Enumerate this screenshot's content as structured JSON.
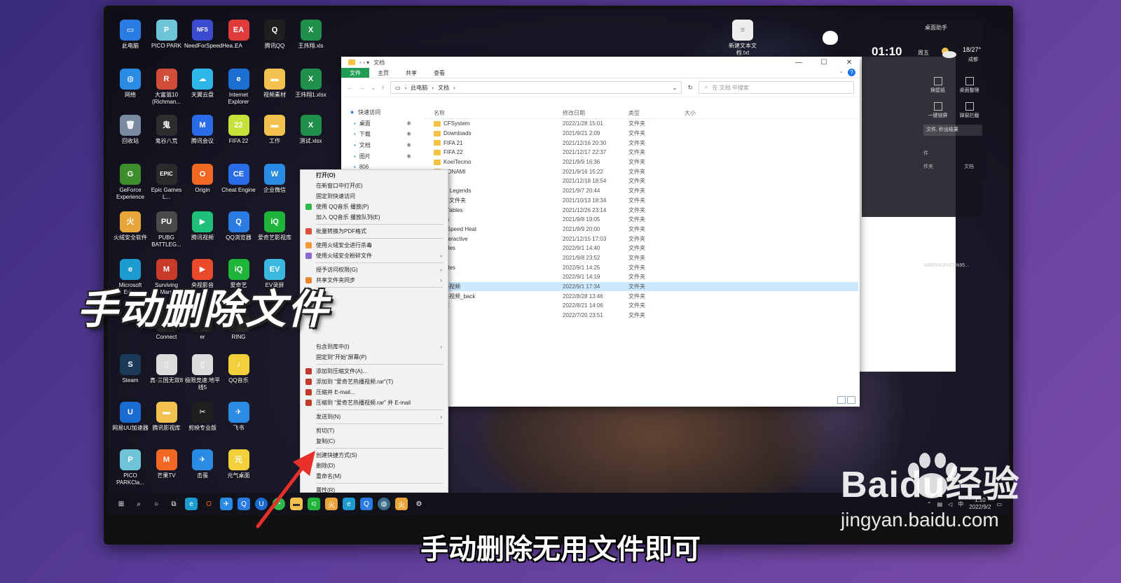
{
  "desktop_icons": [
    {
      "label": "此电脑",
      "color": "#2a7be4",
      "glyph": "▭"
    },
    {
      "label": "PICO PARK",
      "color": "#6fc3d6",
      "glyph": "P"
    },
    {
      "label": "NeedForSpeedHea...",
      "color": "#3b4bd0",
      "glyph": "NFS"
    },
    {
      "label": "EA",
      "color": "#e03a3a",
      "glyph": "EA"
    },
    {
      "label": "腾讯QQ",
      "color": "#1f1f1f",
      "glyph": "Q"
    },
    {
      "label": "王炜翔.xls",
      "color": "#1f8f4c",
      "glyph": "X"
    },
    {
      "label": "网络",
      "color": "#2a8be4",
      "glyph": "◍"
    },
    {
      "label": "大富翁10 (Richman...",
      "color": "#d24c3a",
      "glyph": "R"
    },
    {
      "label": "天翼云盘",
      "color": "#2eb6e8",
      "glyph": "☁"
    },
    {
      "label": "Internet Explorer",
      "color": "#1c6fd0",
      "glyph": "e"
    },
    {
      "label": "视频素材",
      "color": "#f2c14e",
      "glyph": "▬"
    },
    {
      "label": "王炜翔1.xlsx",
      "color": "#1f8f4c",
      "glyph": "X"
    },
    {
      "label": "回收站",
      "color": "#7a8aa0",
      "glyph": "🗑"
    },
    {
      "label": "鬼谷八荒",
      "color": "#2d2d2d",
      "glyph": "鬼"
    },
    {
      "label": "腾讯会议",
      "color": "#2a6be8",
      "glyph": "M"
    },
    {
      "label": "FIFA 22",
      "color": "#c8e03a",
      "glyph": "22"
    },
    {
      "label": "工作",
      "color": "#f2c14e",
      "glyph": "▬"
    },
    {
      "label": "测试.xlsx",
      "color": "#1f8f4c",
      "glyph": "X"
    },
    {
      "label": "GeForce Experience",
      "color": "#3e8e2e",
      "glyph": "G"
    },
    {
      "label": "Epic Games L...",
      "color": "#2a2a2a",
      "glyph": "EPIC"
    },
    {
      "label": "Origin",
      "color": "#f26722",
      "glyph": "O"
    },
    {
      "label": "Cheat Engine",
      "color": "#2a6be8",
      "glyph": "CE"
    },
    {
      "label": "企业微信",
      "color": "#2a8be4",
      "glyph": "W"
    },
    {
      "label": "火绒安全软件",
      "color": "#e8a53a",
      "glyph": "火"
    },
    {
      "label": "PUBG BATTLEG...",
      "color": "#4a4a4a",
      "glyph": "PU"
    },
    {
      "label": "腾讯视频",
      "color": "#1fbf7a",
      "glyph": "▶"
    },
    {
      "label": "QQ浏览器",
      "color": "#2a7be4",
      "glyph": "Q"
    },
    {
      "label": "爱奇艺影视库",
      "color": "#1fb53a",
      "glyph": "iQ"
    },
    {
      "label": "Microsoft Edge",
      "color": "#1c9bd0",
      "glyph": "e"
    },
    {
      "label": "Surviving Mars",
      "color": "#c83a2a",
      "glyph": "M"
    },
    {
      "label": "央视影音",
      "color": "#e84a2a",
      "glyph": "▶"
    },
    {
      "label": "爱奇艺",
      "color": "#1fb53a",
      "glyph": "iQ"
    },
    {
      "label": "EV录屏",
      "color": "#3ab8e0",
      "glyph": "EV"
    },
    {
      "label": "Steam",
      "color": "#1b3a5a",
      "glyph": "S"
    },
    {
      "label": "真·三国无双8",
      "color": "#dcdcdc",
      "glyph": "▯"
    },
    {
      "label": "极限竞速:地平线5",
      "color": "#dcdcdc",
      "glyph": "▯"
    },
    {
      "label": "QQ音乐",
      "color": "#f2d03a",
      "glyph": "♪"
    },
    {
      "label": "网易UU加速器",
      "color": "#1a6bd0",
      "glyph": "U"
    },
    {
      "label": "腾讯影视库",
      "color": "#f2c14e",
      "glyph": "▬"
    },
    {
      "label": "剪映专业版",
      "color": "#1f1f1f",
      "glyph": "✂"
    },
    {
      "label": "飞书",
      "color": "#2a8be4",
      "glyph": "✈"
    },
    {
      "label": "PICO PARKCla...",
      "color": "#6fc3d6",
      "glyph": "P"
    },
    {
      "label": "芒果TV",
      "color": "#f26722",
      "glyph": "M"
    },
    {
      "label": "击蛋",
      "color": "#2a8be4",
      "glyph": "✈"
    },
    {
      "label": "元气桌面",
      "color": "#f2d03a",
      "glyph": "元"
    },
    {
      "label": "Connect",
      "color": "#2a2a2a",
      "glyph": ""
    },
    {
      "label": "er",
      "color": "#2a2a2a",
      "glyph": ""
    },
    {
      "label": "RING",
      "color": "#2a2a2a",
      "glyph": ""
    }
  ],
  "desktop_file": {
    "label": "新建文本文档.txt"
  },
  "explorer": {
    "title": "文档",
    "tabs": [
      "文件",
      "主页",
      "共享",
      "查看"
    ],
    "path": [
      "此电脑",
      "文档"
    ],
    "search_placeholder": "在 文档 中搜索",
    "columns": {
      "name": "名称",
      "date": "修改日期",
      "type": "类型",
      "size": "大小"
    },
    "nav": [
      {
        "label": "快速访问",
        "pinned": false
      },
      {
        "label": "桌面",
        "pinned": true
      },
      {
        "label": "下载",
        "pinned": true
      },
      {
        "label": "文档",
        "pinned": true
      },
      {
        "label": "图片",
        "pinned": true
      },
      {
        "label": "806",
        "pinned": false
      }
    ],
    "files": [
      {
        "name": "CFSystem",
        "date": "2022/1/28 15:01",
        "type": "文件夹"
      },
      {
        "name": "Downloads",
        "date": "2021/9/21 2:09",
        "type": "文件夹"
      },
      {
        "name": "FIFA 21",
        "date": "2021/12/16 20:30",
        "type": "文件夹"
      },
      {
        "name": "FIFA 22",
        "date": "2021/12/17 22:37",
        "type": "文件夹"
      },
      {
        "name": "KoeiTecmo",
        "date": "2021/9/9 16:36",
        "type": "文件夹"
      },
      {
        "name": "KONAMI",
        "date": "2021/9/16 15:22",
        "type": "文件夹"
      },
      {
        "name": "",
        "date": "2021/12/18 18:54",
        "type": "文件夹"
      },
      {
        "name": "of Legends",
        "date": "2021/9/7 20:44",
        "type": "文件夹"
      },
      {
        "name": "享文件夹",
        "date": "2021/10/13 18:34",
        "type": "文件夹"
      },
      {
        "name": "t Tables",
        "date": "2021/12/26 23:14",
        "type": "文件夹"
      },
      {
        "name": "es",
        "date": "2021/9/8 19:05",
        "type": "文件夹"
      },
      {
        "name": "r Speed Heat",
        "date": "2021/9/9 20:00",
        "type": "文件夹"
      },
      {
        "name": "nteractive",
        "date": "2021/12/15 17:03",
        "type": "文件夹"
      },
      {
        "name": "Files",
        "date": "2022/9/1 14:40",
        "type": "文件夹"
      },
      {
        "name": "w",
        "date": "2021/9/8 23:52",
        "type": "文件夹"
      },
      {
        "name": "Files",
        "date": "2022/9/1 14:25",
        "type": "文件夹"
      },
      {
        "name": "",
        "date": "2022/9/1 14:19",
        "type": "文件夹"
      },
      {
        "name": "播视频",
        "date": "2022/9/1 17:34",
        "type": "文件夹",
        "selected": true
      },
      {
        "name": "播视频_back",
        "date": "2022/8/28 13:46",
        "type": "文件夹"
      },
      {
        "name": "库",
        "date": "2022/8/21 14:06",
        "type": "文件夹"
      },
      {
        "name": "",
        "date": "2022/7/20 23:51",
        "type": "文件夹"
      }
    ]
  },
  "context_menu": [
    {
      "label": "打开(O)",
      "bold": true
    },
    {
      "label": "在新窗口中打开(E)"
    },
    {
      "label": "固定到快速访问"
    },
    {
      "label": "使用 QQ音乐 播放(P)",
      "icon": "#2fb94a"
    },
    {
      "label": "加入 QQ音乐 播放队列(E)"
    },
    {
      "sep": true
    },
    {
      "label": "批量转换为PDF格式",
      "icon": "#e04a3a"
    },
    {
      "sep": true
    },
    {
      "label": "使用火绒安全进行杀毒",
      "icon": "#f29a3a"
    },
    {
      "label": "使用火绒安全粉碎文件",
      "icon": "#8a6bd0",
      "sub": true
    },
    {
      "sep": true
    },
    {
      "label": "授予访问权限(G)",
      "sub": true
    },
    {
      "label": "共享文件夹同步",
      "icon": "#e8842a",
      "sub": true
    },
    {
      "sep": true
    },
    {
      "label": ""
    },
    {
      "label": ""
    },
    {
      "label": ""
    },
    {
      "label": "]"
    },
    {
      "label": ""
    },
    {
      "label": "包含到库中(I)",
      "sub": true
    },
    {
      "label": "固定到\"开始\"屏幕(P)"
    },
    {
      "sep": true
    },
    {
      "label": "添加到压缩文件(A)...",
      "icon": "#c0392b"
    },
    {
      "label": "添加到 \"爱奇艺热播视频.rar\"(T)",
      "icon": "#c0392b"
    },
    {
      "label": "压缩并 E-mail...",
      "icon": "#c0392b"
    },
    {
      "label": "压缩到 \"爱奇艺热播视频.rar\" 并 E-mail",
      "icon": "#c0392b"
    },
    {
      "sep": true
    },
    {
      "label": "发送到(N)",
      "sub": true
    },
    {
      "sep": true
    },
    {
      "label": "剪切(T)"
    },
    {
      "label": "复制(C)"
    },
    {
      "sep": true
    },
    {
      "label": "创建快捷方式(S)"
    },
    {
      "label": "删除(D)"
    },
    {
      "label": "重命名(M)"
    },
    {
      "sep": true
    },
    {
      "label": "属性(R)"
    }
  ],
  "widget": {
    "title": "桌面助手",
    "time": "01:10",
    "day": "周五",
    "temp": "18/27°",
    "city": "成都",
    "tools": [
      "换壁纸",
      "桌面整理",
      "一键锁屏",
      "弹窗拦截"
    ],
    "bar": "文件, 秒出结果",
    "notes": [
      "件",
      "件夹",
      "文档",
      "%BB%A3%E5%95..."
    ]
  },
  "tray": {
    "time": "1:10",
    "date": "2022/9/2"
  },
  "overlay": {
    "title": "手动删除文件",
    "subtitle": "手动删除无用文件即可",
    "watermark_logo": "Baidu经验",
    "watermark_url": "jingyan.baidu.com"
  },
  "colors": {
    "accent": "#1f9d55",
    "selection": "#cce8ff",
    "arrow": "#e8302a"
  }
}
